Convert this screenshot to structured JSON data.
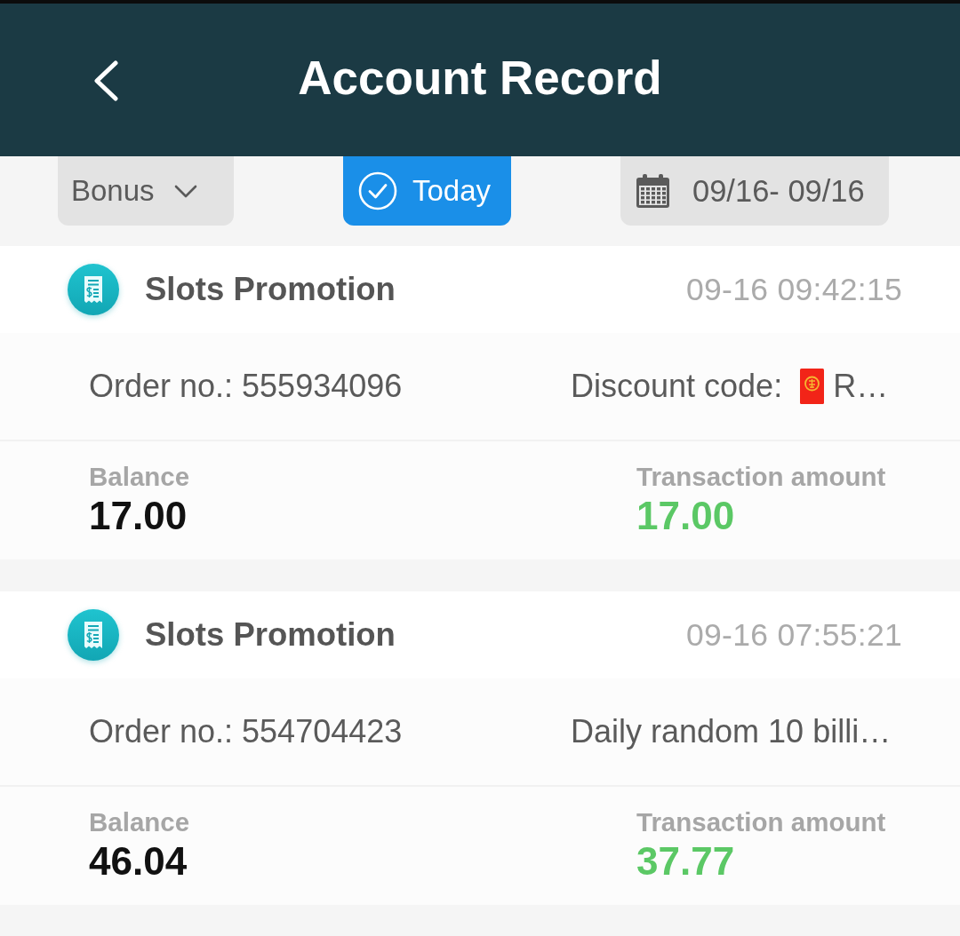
{
  "header": {
    "title": "Account Record"
  },
  "filters": [
    {
      "kind": "dropdown",
      "label": "Bonus",
      "selected": false
    },
    {
      "kind": "toggle",
      "label": "Today",
      "selected": true
    },
    {
      "kind": "date_range",
      "label": "09/16- 09/16",
      "selected": false
    }
  ],
  "records": [
    {
      "title": "Slots Promotion",
      "time": "09-16 09:42:15",
      "order": "Order no.: 555934096",
      "note": {
        "kind": "code",
        "label": "Discount code:",
        "value": "R…"
      },
      "balance_label": "Balance",
      "balance": "17.00",
      "amount_label": "Transaction amount",
      "amount": "17.00"
    },
    {
      "title": "Slots Promotion",
      "time": "09-16 07:55:21",
      "order": "Order no.: 554704423",
      "note": {
        "kind": "text",
        "text": "Daily random 10 billi…"
      },
      "balance_label": "Balance",
      "balance": "46.04",
      "amount_label": "Transaction amount",
      "amount": "37.77"
    }
  ]
}
